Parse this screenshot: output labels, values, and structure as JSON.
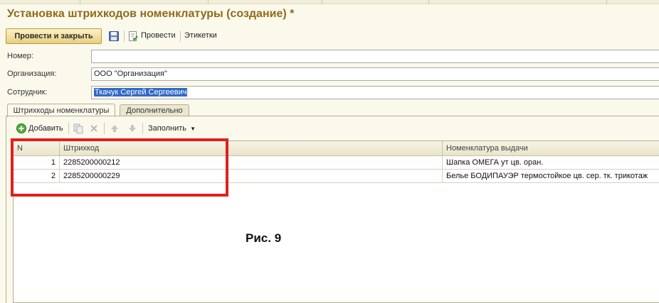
{
  "window": {
    "title": "Установка штрихкодов номенклатуры (создание) *"
  },
  "toolbar": {
    "post_close_label": "Провести и закрыть",
    "post_label": "Провести",
    "labels_label": "Этикетки",
    "save_icon": "floppy-disk-icon",
    "post_icon": "post-document-icon"
  },
  "form": {
    "number_label": "Номер:",
    "number_value": "",
    "org_label": "Организация:",
    "org_value": "ООО \"Организация\"",
    "employee_label": "Сотрудник:",
    "employee_value": "Ткачук Сергей Сергеевич"
  },
  "tabs": [
    {
      "label": "Штрихкоды номенклатуры",
      "active": true
    },
    {
      "label": "Дополнительно",
      "active": false
    }
  ],
  "table_toolbar": {
    "add_label": "Добавить",
    "fill_label": "Заполнить",
    "icons": [
      "add-icon",
      "copy-icon",
      "delete-icon",
      "move-up-icon",
      "move-down-icon"
    ]
  },
  "table": {
    "columns": [
      "N",
      "Штрихкод",
      "Номенклатура выдачи"
    ],
    "rows": [
      {
        "n": "1",
        "barcode": "2285200000212",
        "item": "Шапка ОМЕГА ут цв. оран."
      },
      {
        "n": "2",
        "barcode": "2285200000229",
        "item": "Белье БОДИПАУЭР термостойкое цв. сер. тк. трикотаж"
      }
    ]
  },
  "annotation": {
    "caption": "Рис. 9",
    "highlight_color": "#e0201e"
  },
  "colors": {
    "title": "#8f6a1a",
    "background": "#fbf9ec",
    "selection": "#3269c4"
  }
}
